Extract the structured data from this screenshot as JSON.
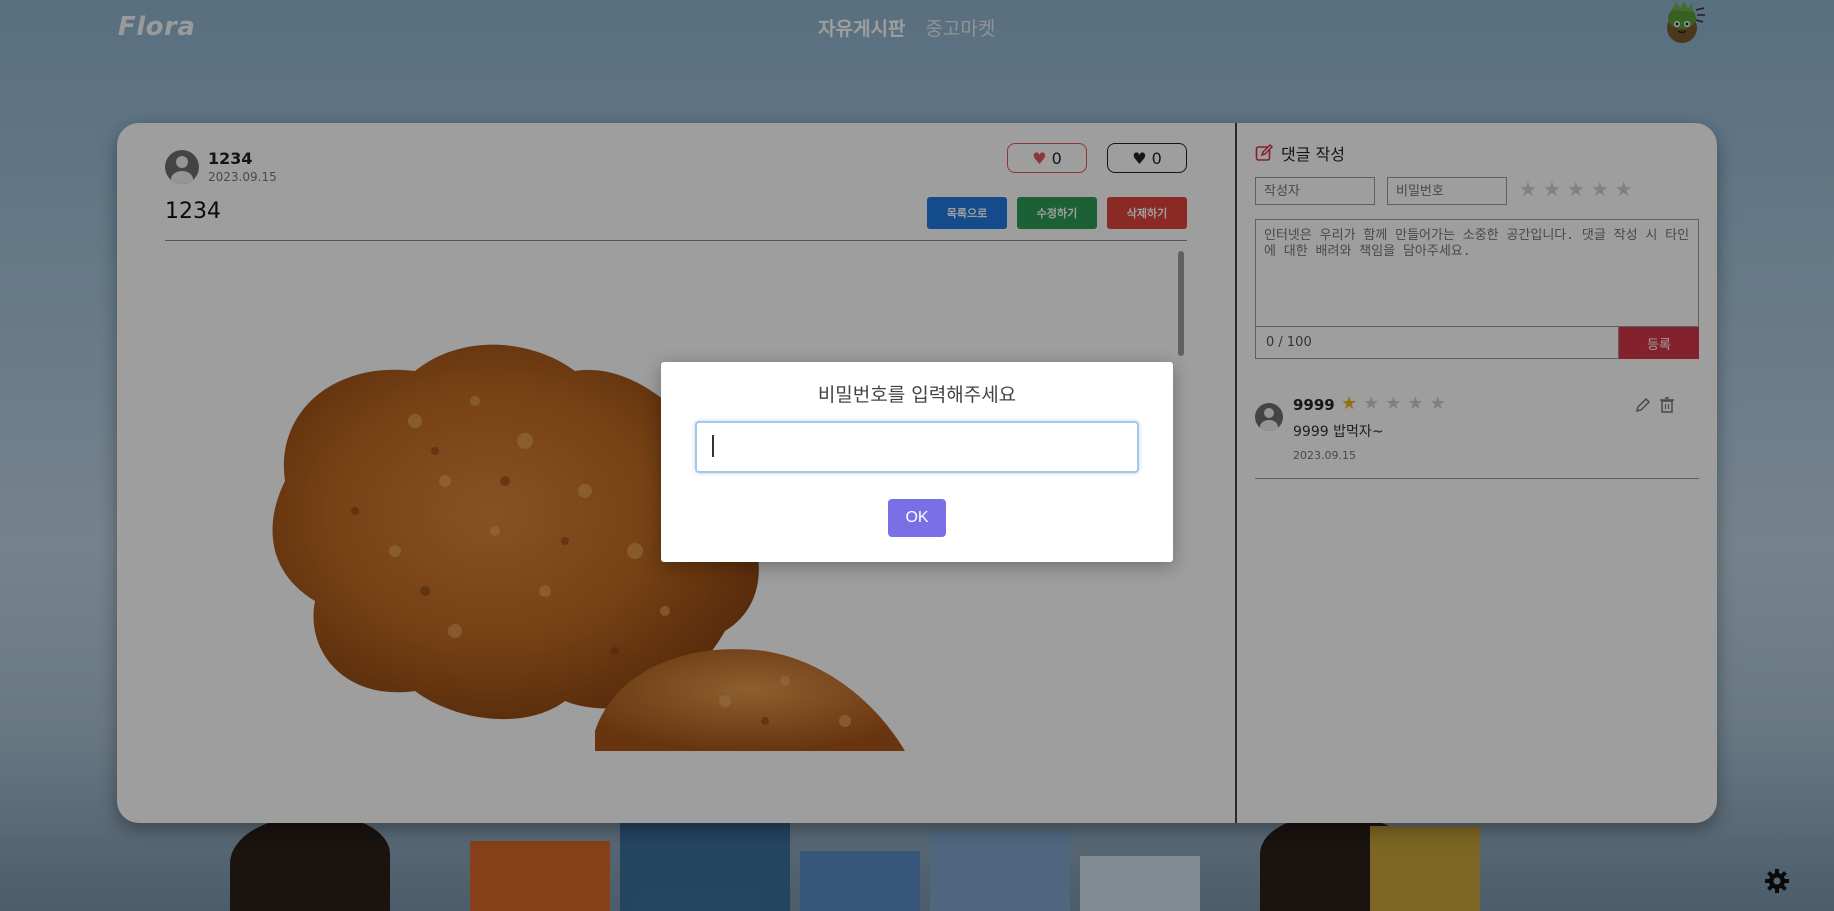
{
  "header": {
    "logo": "Flora",
    "nav": [
      {
        "label": "자유게시판",
        "active": true
      },
      {
        "label": "중고마켓",
        "active": false
      }
    ],
    "profile_icon": "mascot-avatar-icon"
  },
  "post": {
    "author": "1234",
    "date": "2023.09.15",
    "title": "1234",
    "likes": "0",
    "dislikes": "0",
    "buttons": {
      "list": "목록으로",
      "edit": "수정하기",
      "delete": "삭제하기"
    },
    "image": "fried-chicken-photo"
  },
  "comment_form": {
    "title": "댓글 작성",
    "writer_placeholder": "작성자",
    "password_placeholder": "비밀번호",
    "content_placeholder": "인터넷은 우리가 함께 만들어가는 소중한 공간입니다. 댓글 작성 시 타인에 대한 배려와 책임을 담아주세요.",
    "counter": "0 / 100",
    "submit_label": "등록",
    "rating_max": 5
  },
  "comments": [
    {
      "author": "9999",
      "rating": 1,
      "text": "9999 밥먹자~",
      "date": "2023.09.15"
    }
  ],
  "modal": {
    "title": "비밀번호를 입력해주세요",
    "input_value": "",
    "ok_label": "OK"
  },
  "colors": {
    "like": "#e05a5a",
    "btn_list": "#1f7ae0",
    "btn_edit": "#2e9b56",
    "btn_delete": "#e0453d",
    "submit": "#d33848",
    "star_on": "#e8b81a",
    "modal_ok": "#7b6fe8"
  }
}
